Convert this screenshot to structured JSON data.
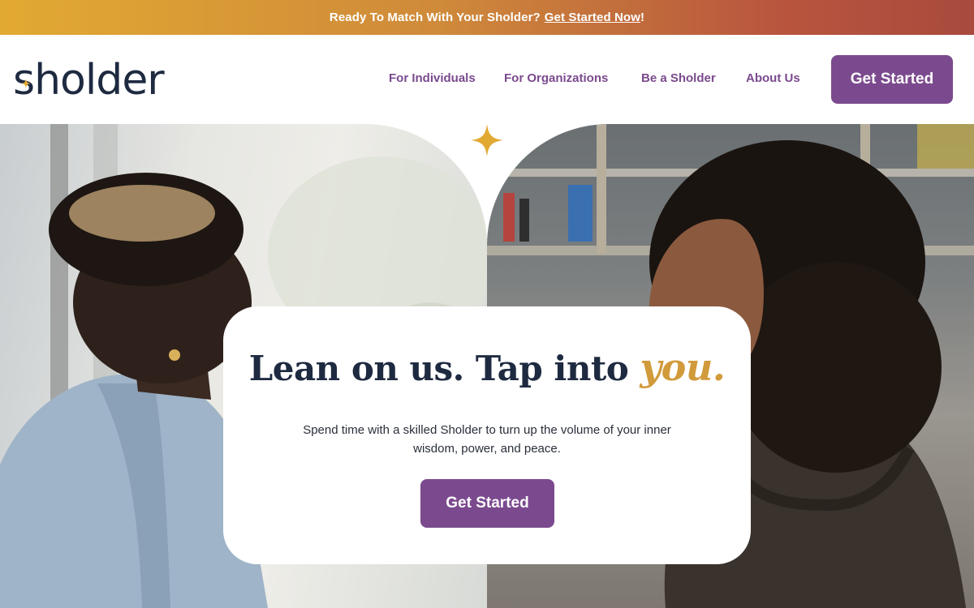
{
  "announcement": {
    "prefix": "Ready To Match With Your Sholder?",
    "link": "Get Started Now",
    "suffix": "!"
  },
  "brand": {
    "logo_text": "sholder",
    "primary_color": "#7b4a8e",
    "accent_color": "#e2a932",
    "ink_color": "#1e2a40"
  },
  "nav": {
    "items": [
      {
        "label": "For Individuals"
      },
      {
        "label": "For Organizations"
      },
      {
        "label": "Be a Sholder"
      },
      {
        "label": "About Us"
      }
    ],
    "cta_label": "Get Started"
  },
  "hero": {
    "headline_main": "Lean on us. Tap into",
    "headline_script": "you",
    "headline_period": ".",
    "subtext": "Spend time with a skilled Sholder to turn up the volume of your inner wisdom, power, and peace.",
    "cta_label": "Get Started",
    "star_icon": "sparkle-icon"
  }
}
